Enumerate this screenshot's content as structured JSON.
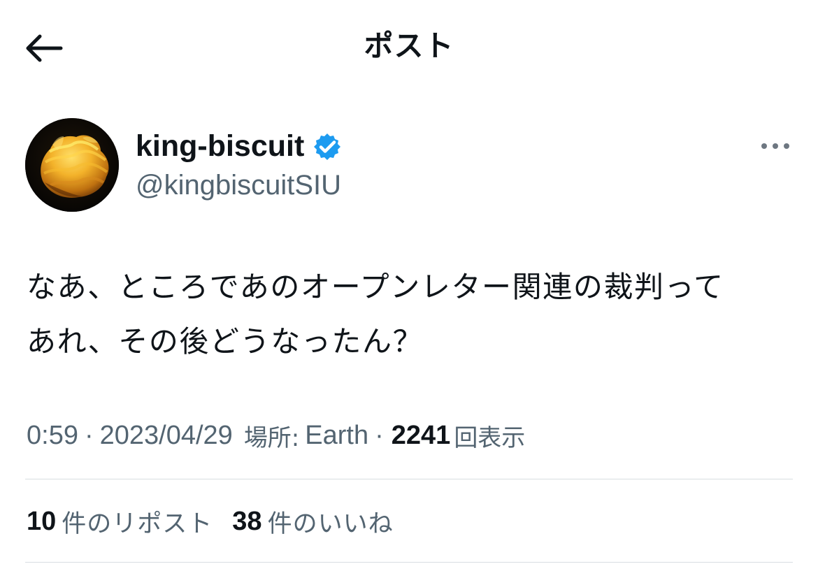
{
  "header": {
    "title": "ポスト",
    "back_icon": "arrow-left-icon"
  },
  "author": {
    "display_name": "king-biscuit",
    "handle": "@kingbiscuitSIU",
    "verified_icon": "verified-badge-icon",
    "avatar_icon": "biscuit-avatar",
    "more_icon": "more-horizontal-icon"
  },
  "post": {
    "text": "なあ、ところであのオープンレター関連の裁判って\nあれ、その後どうなったん？"
  },
  "metadata": {
    "time": "0:59",
    "separator": "·",
    "date": "2023/04/29",
    "location_label": "場所:",
    "location_value": "Earth",
    "views_count": "2241",
    "views_label": "回表示"
  },
  "stats": {
    "reposts_count": "10",
    "reposts_label": "件のリポスト",
    "likes_count": "38",
    "likes_label": "件のいいね"
  },
  "colors": {
    "text_primary": "#0f1419",
    "text_secondary": "#536471",
    "divider": "#d8dde1",
    "verified_blue": "#1d9bf0",
    "background": "#ffffff"
  }
}
